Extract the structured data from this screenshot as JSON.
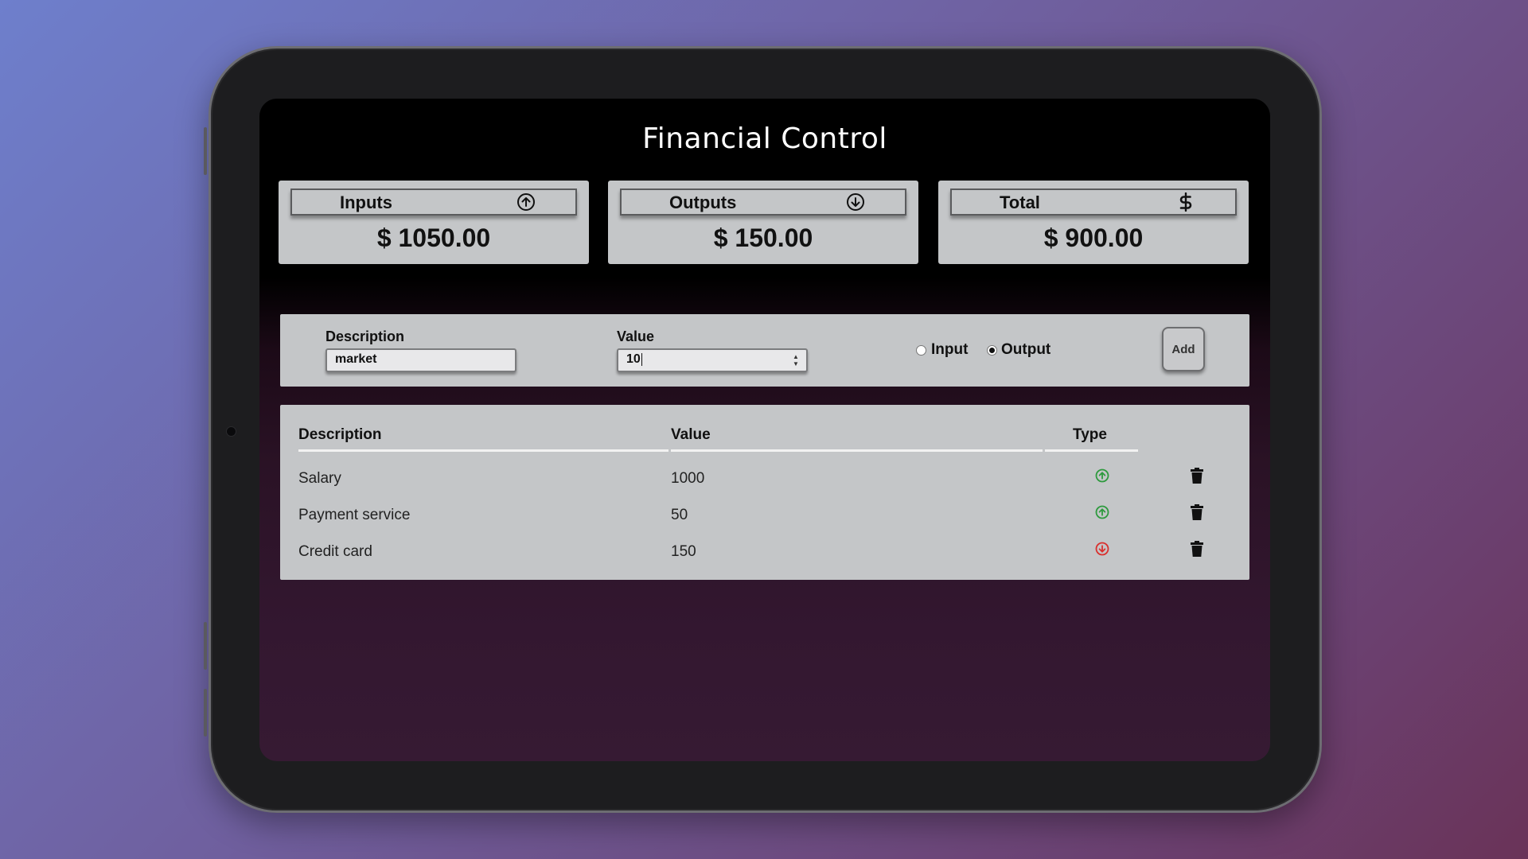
{
  "app": {
    "title": "Financial Control"
  },
  "summary": {
    "inputs": {
      "label": "Inputs",
      "amount": "$ 1050.00",
      "icon": "arrow-up-circle-icon"
    },
    "outputs": {
      "label": "Outputs",
      "amount": "$ 150.00",
      "icon": "arrow-down-circle-icon"
    },
    "total": {
      "label": "Total",
      "amount": "$ 900.00",
      "icon": "dollar-icon"
    }
  },
  "form": {
    "description_label": "Description",
    "description_value": "market",
    "value_label": "Value",
    "value_value": "10",
    "radio_input_label": "Input",
    "radio_output_label": "Output",
    "selected_type": "Output",
    "add_label": "Add"
  },
  "table": {
    "headers": [
      "Description",
      "Value",
      "Type"
    ],
    "rows": [
      {
        "description": "Salary",
        "value": "1000",
        "type": "input"
      },
      {
        "description": "Payment service",
        "value": "50",
        "type": "input"
      },
      {
        "description": "Credit card",
        "value": "150",
        "type": "output"
      }
    ]
  },
  "colors": {
    "input_icon": "#2e9a3e",
    "output_icon": "#d9302e",
    "panel": "#c4c6c8"
  }
}
